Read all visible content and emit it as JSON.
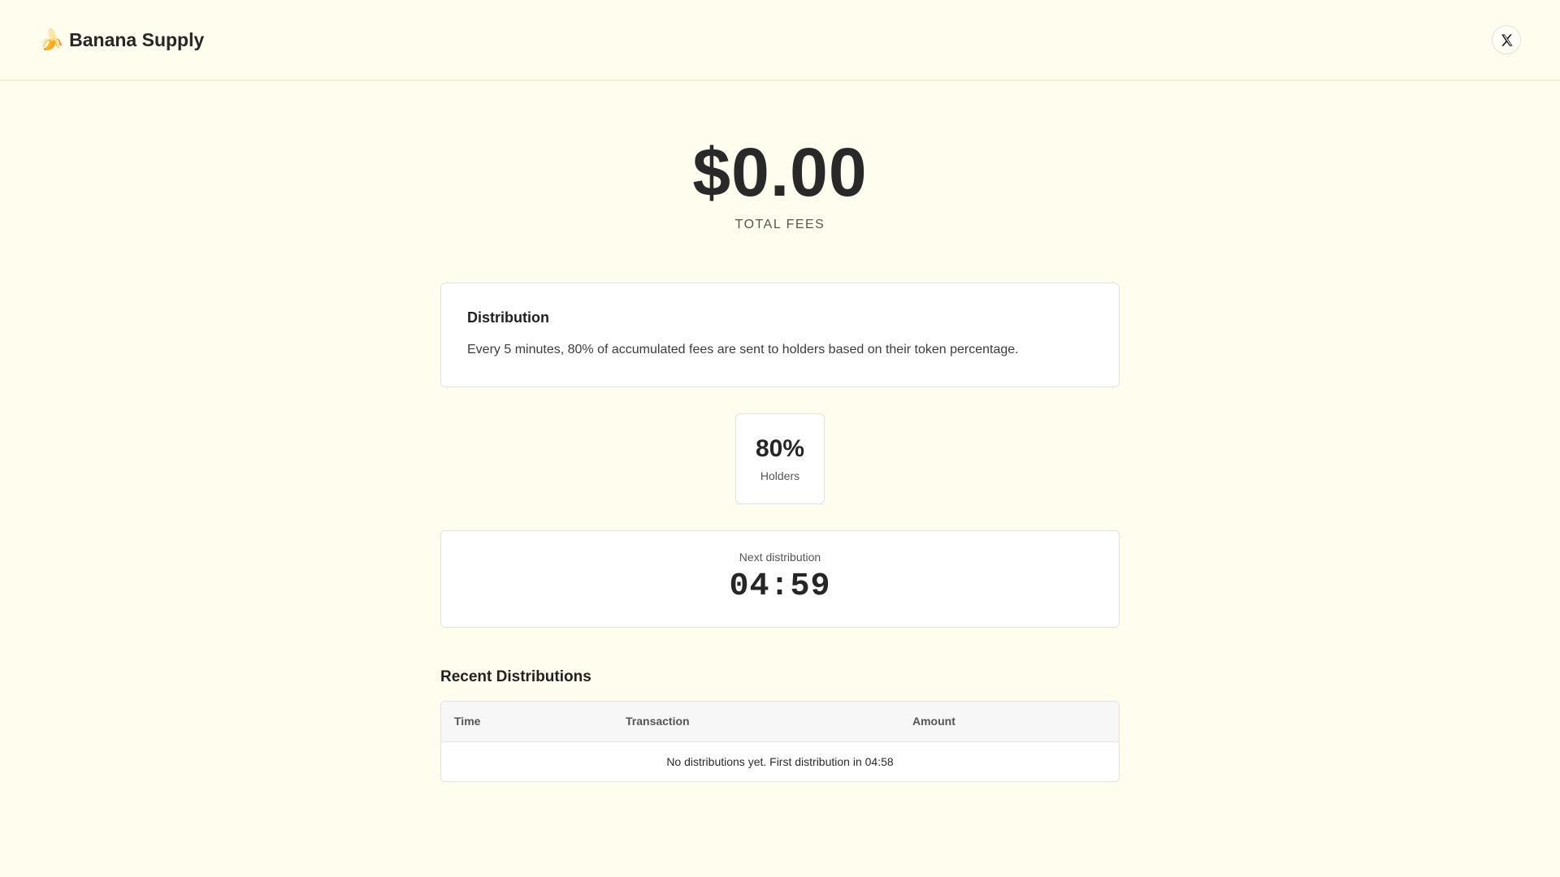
{
  "header": {
    "logo_emoji": "🍌",
    "brand_name": "Banana Supply",
    "x_icon": "x-logo-icon"
  },
  "hero": {
    "amount": "$0.00",
    "label": "TOTAL FEES"
  },
  "distribution": {
    "title": "Distribution",
    "description": "Every 5 minutes, 80% of accumulated fees are sent to holders based on their token percentage."
  },
  "stat": {
    "value": "80%",
    "label": "Holders"
  },
  "timer": {
    "label": "Next distribution",
    "value": "04:59"
  },
  "recent": {
    "title": "Recent Distributions",
    "columns": [
      "Time",
      "Transaction",
      "Amount"
    ],
    "empty_message": "No distributions yet. First distribution in 04:58"
  },
  "colors": {
    "background": "#fffdee",
    "card": "#ffffff",
    "text": "#2a2a2a"
  }
}
